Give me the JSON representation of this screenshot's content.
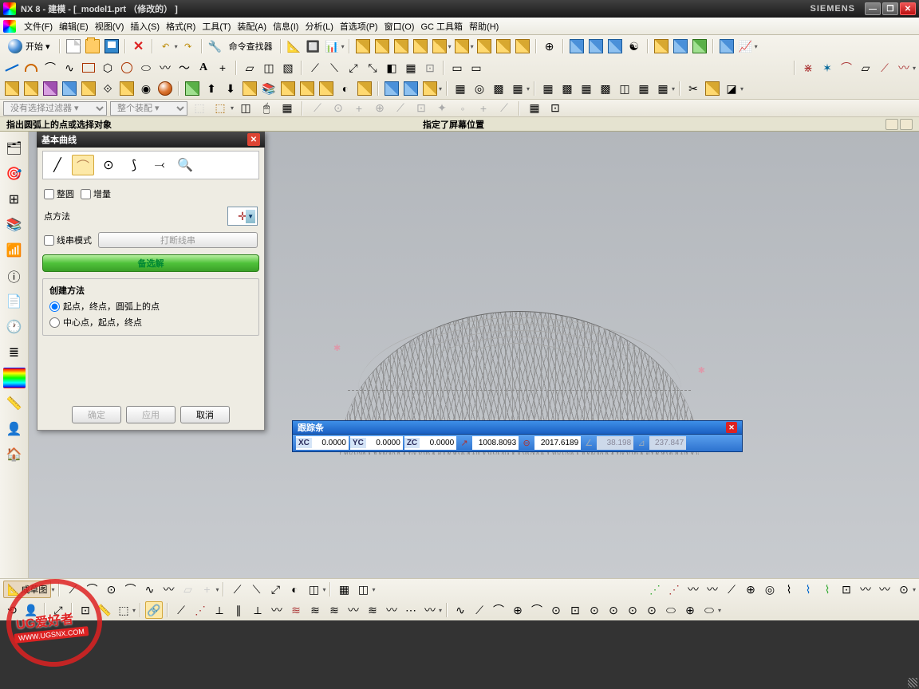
{
  "titlebar": {
    "text": "NX 8 - 建模 - [_model1.prt （修改的） ]",
    "brand": "SIEMENS"
  },
  "menu": {
    "items": [
      "文件(F)",
      "编辑(E)",
      "视图(V)",
      "插入(S)",
      "格式(R)",
      "工具(T)",
      "装配(A)",
      "信息(I)",
      "分析(L)",
      "首选项(P)",
      "窗口(O)",
      "GC 工具箱",
      "帮助(H)"
    ]
  },
  "start": {
    "label": "开始 ▾"
  },
  "cmdfind": {
    "label": "命令查找器"
  },
  "filter1": "没有选择过滤器 ▾",
  "filter2": "整个装配 ▾",
  "prompt": {
    "left": "指出圆弧上的点或选择对象",
    "right": "指定了屏幕位置"
  },
  "trackbar": {
    "title": "跟踪条",
    "fields": [
      {
        "label": "XC",
        "value": "0.0000"
      },
      {
        "label": "YC",
        "value": "0.0000"
      },
      {
        "label": "ZC",
        "value": "0.0000"
      }
    ],
    "extra": [
      {
        "value": "1008.8093"
      },
      {
        "value": "2017.6189"
      }
    ],
    "dim": [
      {
        "value": "38.198"
      },
      {
        "value": "237.847"
      }
    ]
  },
  "dialog": {
    "title": "基本曲线",
    "full_circle": "整圆",
    "increment": "增量",
    "point_method": "点方法",
    "string_mode": "线串模式",
    "break_string": "打断线串",
    "alt_solution": "备选解",
    "group_title": "创建方法",
    "radio1": "起点，终点，圆弧上的点",
    "radio2": "中心点，起点，终点",
    "ok": "确定",
    "apply": "应用",
    "cancel": "取消"
  },
  "sketch_btn": "成草图",
  "watermark": {
    "main": "UG爱好者",
    "sub": "WWW.UGSNX.COM"
  }
}
